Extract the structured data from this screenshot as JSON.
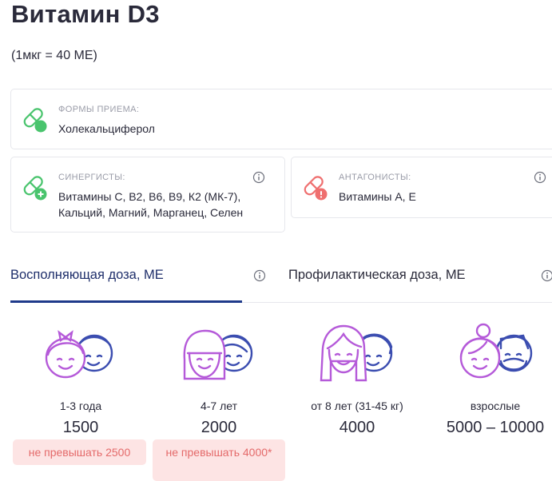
{
  "title": "Витамин D3",
  "subtitle": "(1мкг = 40 МЕ)",
  "forms": {
    "label": "ФОРМЫ ПРИЕМА:",
    "value": "Холекальциферол",
    "icon": "pill-green-icon"
  },
  "synergists": {
    "label": "СИНЕРГИСТЫ:",
    "value": "Витамины С, В2, В6, В9, К2 (МК-7), Кальций, Магний, Марганец, Селен",
    "icon": "pill-plus-icon"
  },
  "antagonists": {
    "label": "АНТАГОНИСТЫ:",
    "value": "Витамины А, Е",
    "icon": "pill-warning-icon"
  },
  "tabs": [
    {
      "label": "Восполняющая доза, МЕ",
      "active": true
    },
    {
      "label": "Профилактическая доза, МЕ",
      "active": false
    }
  ],
  "groups": [
    {
      "label": "1-3 года",
      "value": "1500",
      "warning": "не превышать 2500"
    },
    {
      "label": "4-7 лет",
      "value": "2000",
      "warning": "не превышать 4000*"
    },
    {
      "label": "от 8 лет (31-45 кг)",
      "value": "4000",
      "warning": ""
    },
    {
      "label": "взрослые",
      "value": "5000 – 10000",
      "warning": ""
    }
  ],
  "colors": {
    "green": "#49c46d",
    "red": "#ef6f6f",
    "purple": "#b55ad9",
    "navy": "#3b4db0",
    "tab_active": "#1f3a8a"
  }
}
